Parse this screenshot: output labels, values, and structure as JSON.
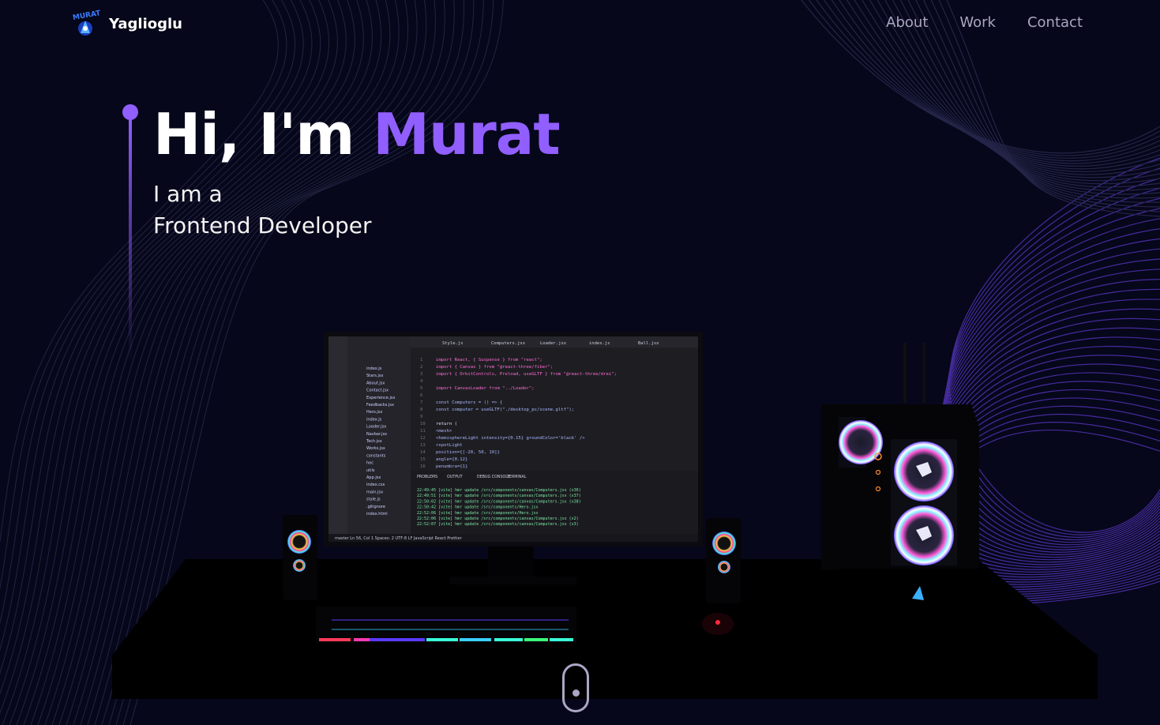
{
  "nav": {
    "brand": "Yaglioglu",
    "links": [
      {
        "label": "About"
      },
      {
        "label": "Work"
      },
      {
        "label": "Contact"
      }
    ]
  },
  "hero": {
    "greeting": "Hi, I'm",
    "name": "Murat",
    "subtitle_line1": "I am a",
    "subtitle_line2": "Frontend Developer"
  },
  "scene": {
    "editor_tabs": [
      "Style.js",
      "Computers.jsx",
      "Loader.jsx",
      "index.js",
      "Ball.jsx"
    ],
    "explorer_files": [
      "index.js",
      "Stars.jsx",
      "About.jsx",
      "Contact.jsx",
      "Experience.jsx",
      "Feedbacks.jsx",
      "Hero.jsx",
      "index.js",
      "Loader.jsx",
      "Navbar.jsx",
      "Tech.jsx",
      "Works.jsx",
      "constants",
      "hoc",
      "utils",
      "App.jsx",
      "index.css",
      "main.jsx",
      "style.js",
      ".gitignore",
      "index.html"
    ],
    "code_lines": [
      "import React, { Suspense } from \"react\";",
      "import { Canvas } from \"@react-three/fiber\";",
      "import { OrbitControls, Preload, useGLTF } from \"@react-three/drei\";",
      "",
      "import CanvasLoader from \"../Loader\";",
      "",
      "const Computers = () => {",
      "  const computer = useGLTF(\"./desktop_pc/scene.gltf\");",
      "",
      "  return (",
      "    <mesh>",
      "      <hemisphereLight intensity={0.15} groundColor='black' />",
      "      <spotLight",
      "        position={[-20, 50, 10]}",
      "        angle={0.12}",
      "        penumbra={1}"
    ],
    "terminal_lines": [
      "22:49:45 [vite] hmr update /src/components/canvas/Computers.jsx (x36)",
      "22:49:51 [vite] hmr update /src/components/canvas/Computers.jsx (x37)",
      "22:50:02 [vite] hmr update /src/components/canvas/Computers.jsx (x38)",
      "22:50:42 [vite] hmr update /src/components/Hero.jsx",
      "22:52:06 [vite] hmr update /src/components/Hero.jsx",
      "22:52:06 [vite] hmr update /src/components/canvas/Computers.jsx (x2)",
      "22:52:07 [vite] hmr update /src/components/canvas/Computers.jsx (x3)"
    ],
    "panel_tabs": [
      "PROBLEMS",
      "OUTPUT",
      "DEBUG CONSOLE",
      "TERMINAL"
    ],
    "status_bar": "master   Ln 56, Col 1   Spaces: 2   UTF-8   LF   JavaScript React   Prettier"
  },
  "colors": {
    "accent": "#915eff",
    "background": "#06071a",
    "nav_text": "#aaa6c3"
  }
}
